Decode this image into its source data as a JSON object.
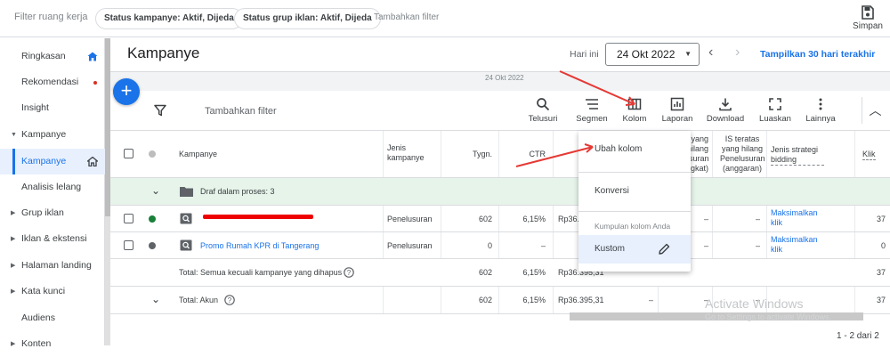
{
  "filterbar": {
    "label": "Filter ruang kerja",
    "chips": [
      "Status kampanye: Aktif, Dijeda",
      "Status grup iklan: Aktif, Dijeda"
    ],
    "add": "Tambahkan filter",
    "save": "Simpan"
  },
  "nav": {
    "items": [
      {
        "label": "Ringkasan"
      },
      {
        "label": "Rekomendasi"
      },
      {
        "label": "Insight"
      },
      {
        "label": "Kampanye"
      },
      {
        "label": "Kampanye"
      },
      {
        "label": "Analisis lelang"
      },
      {
        "label": "Grup iklan"
      },
      {
        "label": "Iklan & ekstensi"
      },
      {
        "label": "Halaman landing"
      },
      {
        "label": "Kata kunci"
      },
      {
        "label": "Audiens"
      },
      {
        "label": "Konten"
      }
    ]
  },
  "header": {
    "title": "Kampanye",
    "date_prefix": "Hari ini",
    "date": "24 Okt 2022",
    "show30": "Tampilkan 30 hari terakhir",
    "chart_date": "24 Okt 2022"
  },
  "toolbar": {
    "add_filter": "Tambahkan filter",
    "tools": [
      "Telusuri",
      "Segmen",
      "Kolom",
      "Laporan",
      "Download",
      "Luaskan",
      "Lainnya"
    ]
  },
  "table": {
    "headers": {
      "campaign": "Kampanye",
      "type": "Jenis kampanye",
      "budget": "Tygn.",
      "ctr": "CTR",
      "is_lost1": "IS yang hilang Penelusuran (peringkat)",
      "is_lost2": "IS teratas yang hilang Penelusuran (anggaran)",
      "bid": "Jenis strategi bidding",
      "clicks": "Klik"
    },
    "draft": "Draf dalam proses: 3",
    "rows": [
      {
        "name": "",
        "type": "Penelusuran",
        "budget": "602",
        "ctr": "6,15%",
        "cost": "Rp36.",
        "d1": "–",
        "d2": "–",
        "bid": "Maksimalkan klik",
        "clicks": "37"
      },
      {
        "name": "Promo Rumah KPR di Tangerang",
        "type": "Penelusuran",
        "budget": "0",
        "ctr": "–",
        "cost": "",
        "d1": "–",
        "d2": "–",
        "bid": "Maksimalkan klik",
        "clicks": "0"
      }
    ],
    "total1": {
      "label": "Total: Semua kecuali kampanye yang dihapus",
      "budget": "602",
      "ctr": "6,15%",
      "cost": "Rp36.395,31",
      "clicks": "37"
    },
    "total2": {
      "label": "Total: Akun",
      "budget": "602",
      "ctr": "6,15%",
      "cost": "Rp36.395,31",
      "d0": "–",
      "d1": "–",
      "d2": "–",
      "clicks": "37"
    }
  },
  "menu": {
    "edit": "Ubah kolom",
    "conversion": "Konversi",
    "group_label": "Kumpulan kolom Anda",
    "custom": "Kustom"
  },
  "watermark": {
    "title": "Activate Windows",
    "sub": "Go to Settings to activate Windows."
  },
  "pager": "1 - 2 dari 2",
  "colors": {
    "accent": "#1a73e8",
    "green_row": "#e6f4ea",
    "arrow": "#e53935"
  }
}
